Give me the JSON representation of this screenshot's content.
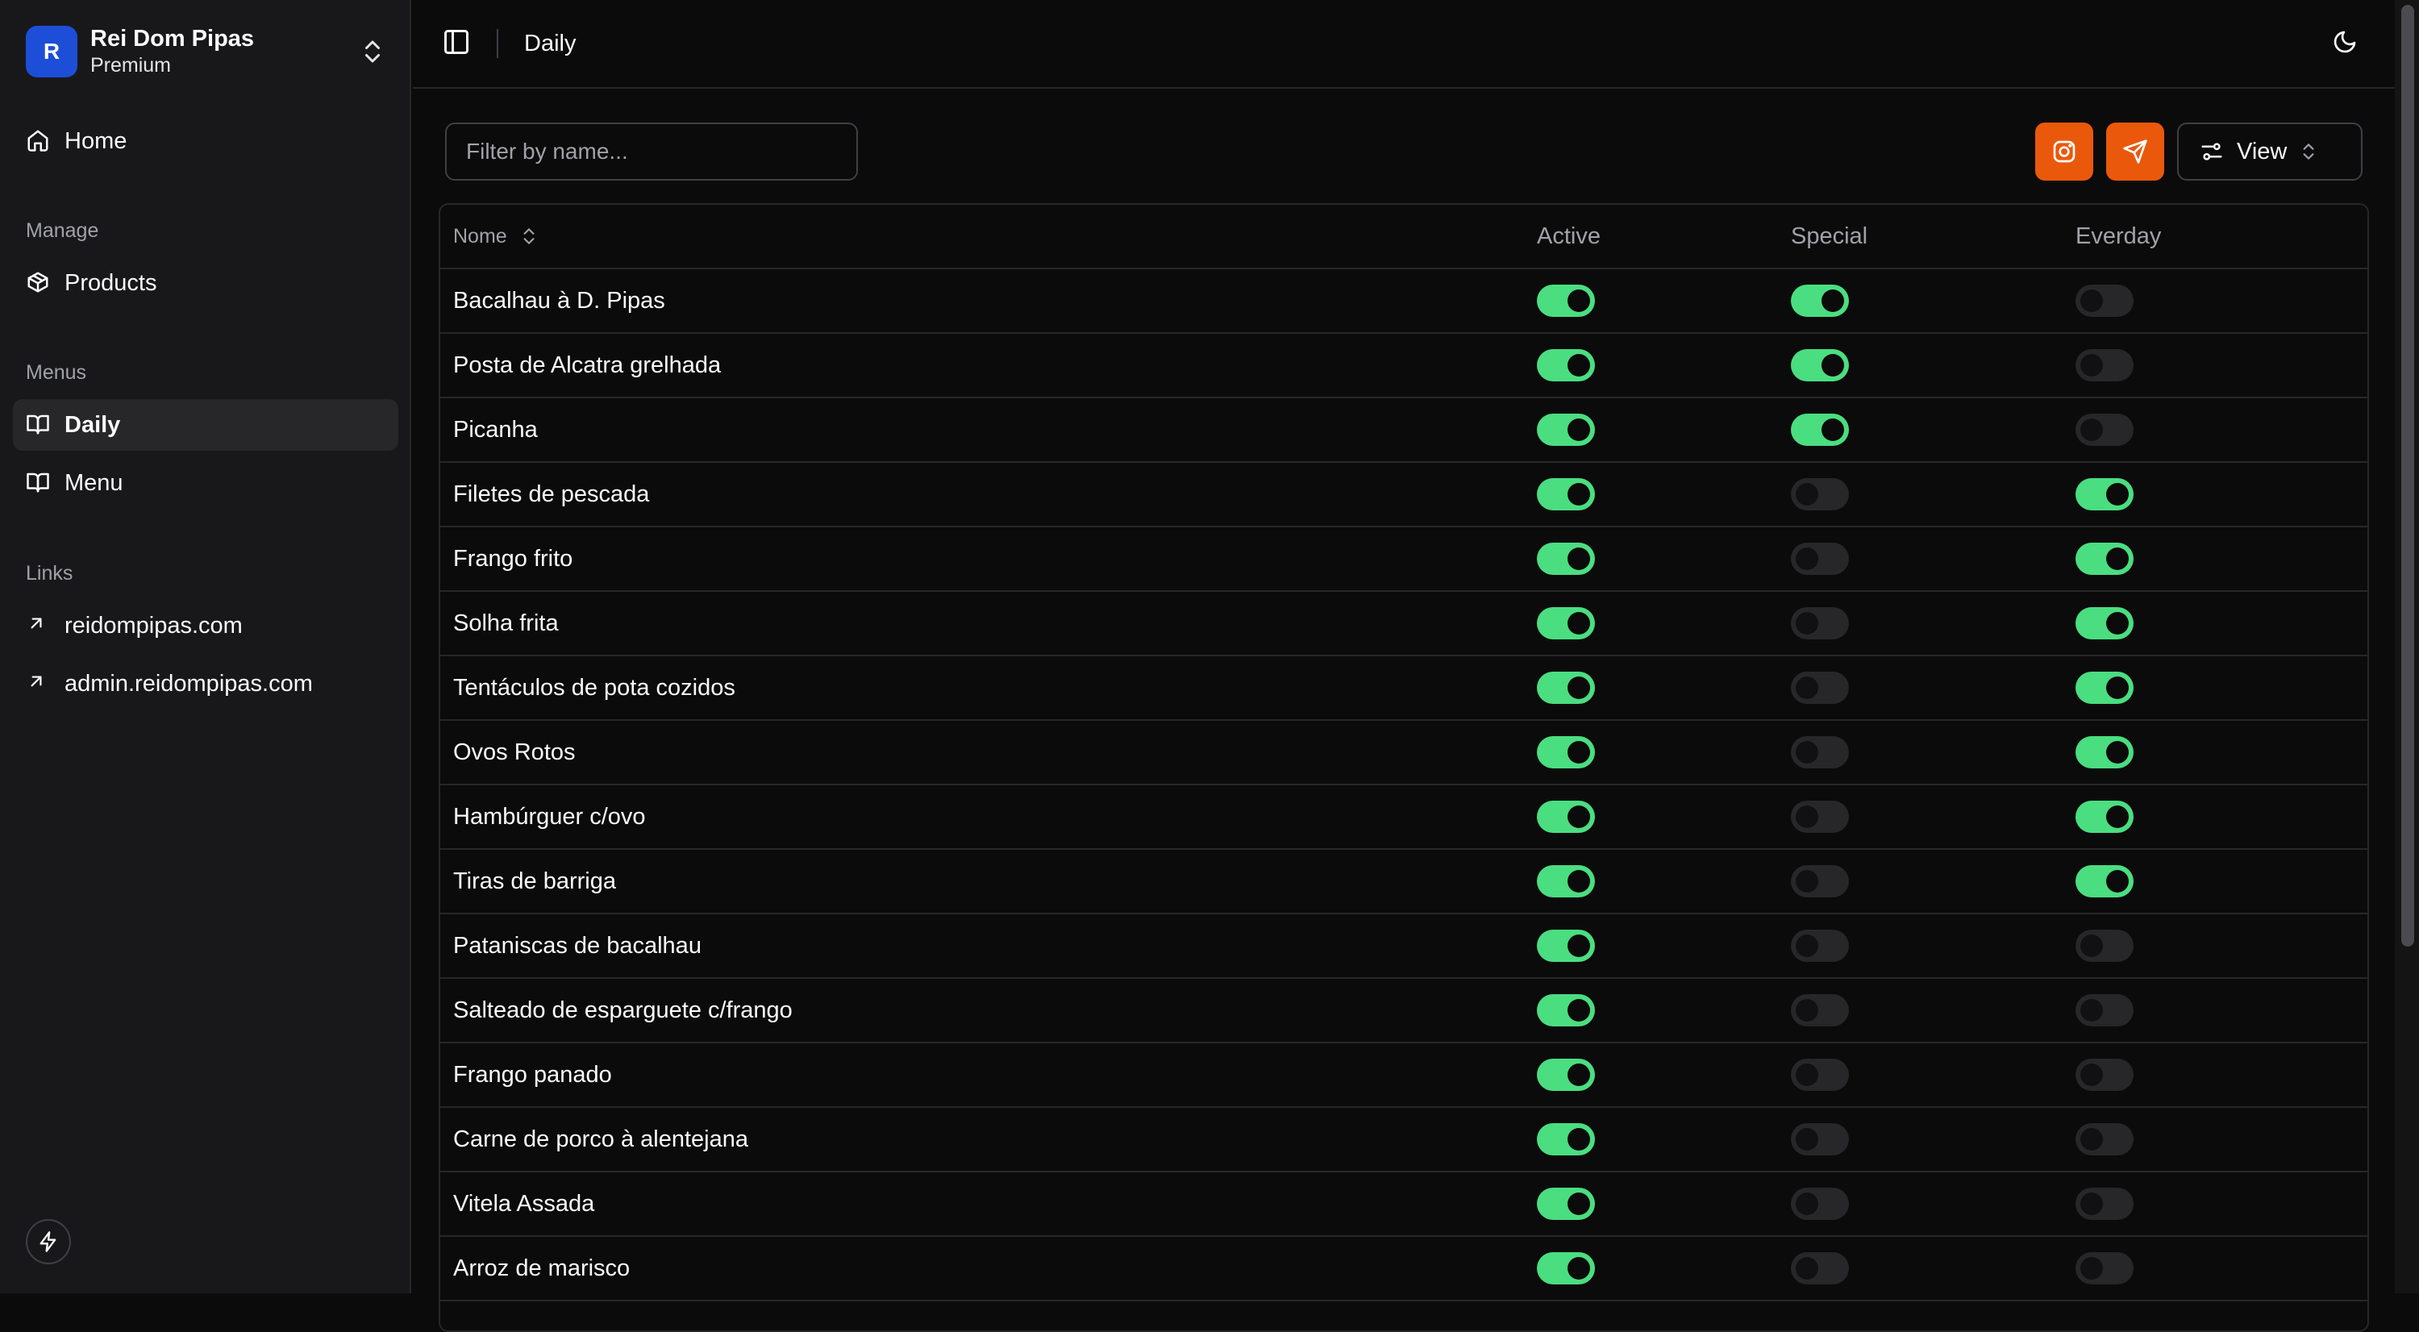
{
  "sidebar": {
    "brand": {
      "initial": "R",
      "name": "Rei Dom Pipas",
      "plan": "Premium"
    },
    "home": "Home",
    "groups": {
      "manage": "Manage",
      "menus": "Menus",
      "links": "Links"
    },
    "items": {
      "products": "Products",
      "daily": "Daily",
      "menu": "Menu"
    },
    "links": [
      "reidompipas.com",
      "admin.reidompipas.com"
    ]
  },
  "header": {
    "title": "Daily"
  },
  "toolbar": {
    "filter_placeholder": "Filter by name...",
    "view_label": "View"
  },
  "colors": {
    "accent": "#ea580c",
    "toggle_on": "#4ade80",
    "brand": "#1d4ed8"
  },
  "table": {
    "columns": {
      "name": "Nome",
      "active": "Active",
      "special": "Special",
      "everyday": "Everday"
    },
    "rows": [
      {
        "name": "Bacalhau à D. Pipas",
        "active": true,
        "special": true,
        "everyday": false
      },
      {
        "name": "Posta de Alcatra grelhada",
        "active": true,
        "special": true,
        "everyday": false
      },
      {
        "name": "Picanha",
        "active": true,
        "special": true,
        "everyday": false
      },
      {
        "name": "Filetes de pescada",
        "active": true,
        "special": false,
        "everyday": true
      },
      {
        "name": "Frango frito",
        "active": true,
        "special": false,
        "everyday": true
      },
      {
        "name": "Solha frita",
        "active": true,
        "special": false,
        "everyday": true
      },
      {
        "name": "Tentáculos de pota cozidos",
        "active": true,
        "special": false,
        "everyday": true
      },
      {
        "name": "Ovos Rotos",
        "active": true,
        "special": false,
        "everyday": true
      },
      {
        "name": "Hambúrguer c/ovo",
        "active": true,
        "special": false,
        "everyday": true
      },
      {
        "name": "Tiras de barriga",
        "active": true,
        "special": false,
        "everyday": true
      },
      {
        "name": "Pataniscas de bacalhau",
        "active": true,
        "special": false,
        "everyday": false
      },
      {
        "name": "Salteado de esparguete c/frango",
        "active": true,
        "special": false,
        "everyday": false
      },
      {
        "name": "Frango panado",
        "active": true,
        "special": false,
        "everyday": false
      },
      {
        "name": "Carne de porco à alentejana",
        "active": true,
        "special": false,
        "everyday": false
      },
      {
        "name": "Vitela Assada",
        "active": true,
        "special": false,
        "everyday": false
      },
      {
        "name": "Arroz de marisco",
        "active": true,
        "special": false,
        "everyday": false
      }
    ]
  }
}
